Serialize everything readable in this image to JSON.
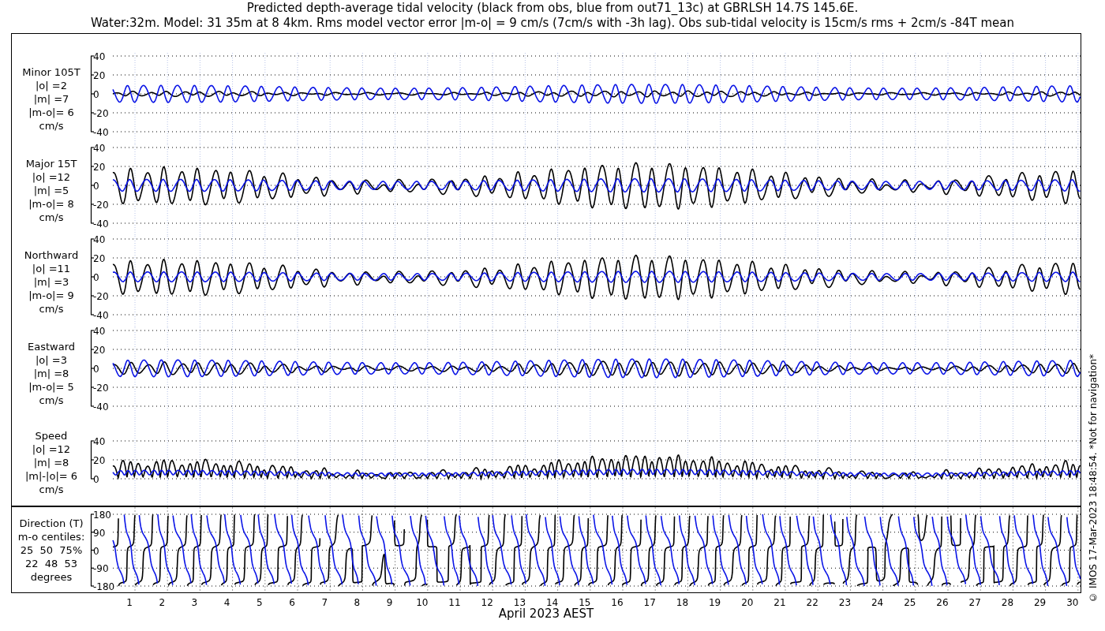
{
  "title_lines": [
    "Predicted depth-average tidal velocity (black from obs, blue from out71_13c) at GBRLSH 14.7S 145.6E.",
    "Water:32m. Model: 31 35m at 8 4km. Rms model vector error |m-o| = 9 cm/s (7cm/s with -3h lag). Obs sub-tidal velocity is 15cm/s rms + 2cm/s -84T mean"
  ],
  "panels": [
    {
      "kind": "velocity",
      "label_lines": [
        "Minor 105T",
        "|o| =2",
        "|m| =7",
        "|m-o|= 6",
        "cm/s"
      ],
      "yticks": [
        "40",
        "20",
        "0",
        "-20",
        "-40"
      ]
    },
    {
      "kind": "velocity",
      "label_lines": [
        "Major 15T",
        "|o| =12",
        "|m| =5",
        "|m-o|= 8",
        "cm/s"
      ],
      "yticks": [
        "40",
        "20",
        "0",
        "-20",
        "-40"
      ]
    },
    {
      "kind": "velocity",
      "label_lines": [
        "Northward",
        "|o| =11",
        "|m| =3",
        "|m-o|= 9",
        "cm/s"
      ],
      "yticks": [
        "40",
        "20",
        "0",
        "-20",
        "-40"
      ]
    },
    {
      "kind": "velocity",
      "label_lines": [
        "Eastward",
        "|o| =3",
        "|m| =8",
        "|m-o|= 5",
        "cm/s"
      ],
      "yticks": [
        "40",
        "20",
        "0",
        "-20",
        "-40"
      ]
    },
    {
      "kind": "speed",
      "label_lines": [
        "Speed",
        "|o| =12",
        "|m| =8",
        "|m|-|o|= 6",
        "cm/s"
      ],
      "yticks": [
        "40",
        "20",
        "0"
      ]
    },
    {
      "kind": "direction",
      "label_lines": [
        "Direction (T)",
        "m-o centiles:",
        "25  50  75%",
        "22  48  53",
        "degrees"
      ],
      "yticks": [
        "180",
        "90",
        "0",
        "-90",
        "-180"
      ]
    }
  ],
  "x_axis": {
    "ticks": [
      "1",
      "2",
      "3",
      "4",
      "5",
      "6",
      "7",
      "8",
      "9",
      "10",
      "11",
      "12",
      "13",
      "14",
      "15",
      "16",
      "17",
      "18",
      "19",
      "20",
      "21",
      "22",
      "23",
      "24",
      "25",
      "26",
      "27",
      "28",
      "29",
      "30"
    ],
    "label": "April 2023 AEST"
  },
  "side_note": "© IMOS 17-Mar-2023 18:48:54. *Not for navigation*"
}
